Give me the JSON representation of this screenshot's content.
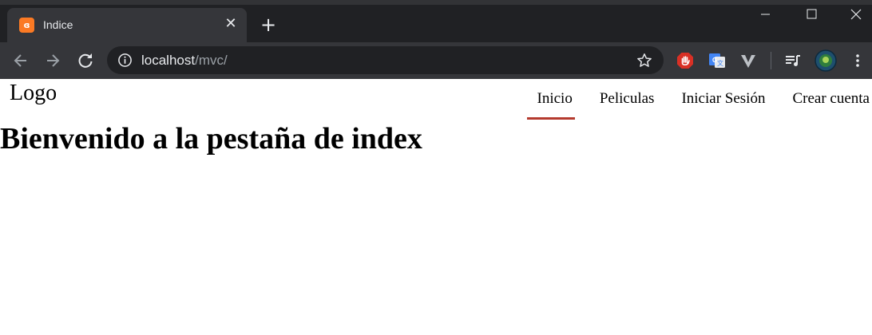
{
  "browser": {
    "tab": {
      "title": "Indice",
      "favicon": "xampp-favicon-icon"
    },
    "new_tab_label": "+",
    "address": {
      "host": "localhost",
      "path": "/mvc/"
    },
    "colors": {
      "frame": "#202124",
      "toolbar": "#35363a",
      "favicon": "#fb7a24",
      "text": "#e8eaed",
      "path": "#9aa0a6"
    },
    "extensions": [
      "adblock-icon",
      "google-translate-icon",
      "vivaldi-icon",
      "media-queue-icon",
      "profile-avatar-icon",
      "menu-kebab-icon"
    ]
  },
  "site": {
    "logo": "Logo",
    "nav": {
      "items": [
        {
          "label": "Inicio",
          "active": true
        },
        {
          "label": "Peliculas",
          "active": false
        },
        {
          "label": "Iniciar Sesión",
          "active": false
        },
        {
          "label": "Crear cuenta",
          "active": false
        }
      ],
      "active_color": "#b43a2e"
    },
    "heading": "Bienvenido a la pestaña de index"
  }
}
